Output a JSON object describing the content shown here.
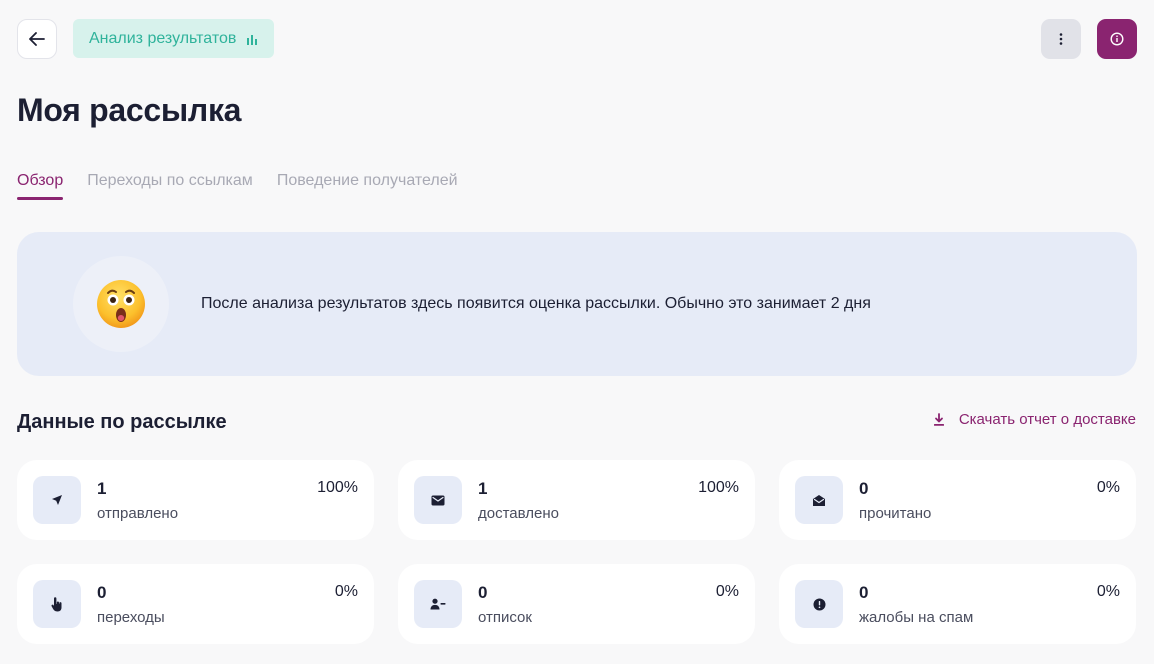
{
  "header": {
    "back_icon": "arrow-left-icon",
    "analysis_label": "Анализ результатов",
    "analysis_icon": "bar-chart-icon",
    "more_icon": "more-vertical-icon",
    "info_icon": "info-icon"
  },
  "page_title": "Моя рассылка",
  "tabs": [
    {
      "label": "Обзор",
      "active": true
    },
    {
      "label": "Переходы по ссылкам",
      "active": false
    },
    {
      "label": "Поведение получателей",
      "active": false
    }
  ],
  "notice": {
    "emoji": "😲",
    "text": "После анализа результатов здесь появится оценка рассылки. Обычно это занимает 2 дня"
  },
  "section": {
    "title": "Данные по рассылке",
    "download_label": "Скачать отчет о доставке",
    "download_icon": "download-icon"
  },
  "stats": [
    {
      "value": "1",
      "label": "отправлено",
      "percent": "100%",
      "icon": "send-icon"
    },
    {
      "value": "1",
      "label": "доставлено",
      "percent": "100%",
      "icon": "envelope-icon"
    },
    {
      "value": "0",
      "label": "прочитано",
      "percent": "0%",
      "icon": "open-envelope-icon"
    },
    {
      "value": "0",
      "label": "переходы",
      "percent": "0%",
      "icon": "pointer-hand-icon"
    },
    {
      "value": "0",
      "label": "отписок",
      "percent": "0%",
      "icon": "user-minus-icon"
    },
    {
      "value": "0",
      "label": "жалобы на спам",
      "percent": "0%",
      "icon": "alert-circle-icon"
    }
  ],
  "colors": {
    "accent": "#8a2470",
    "chip_bg": "#d7f2ec",
    "chip_text": "#2fb39b",
    "notice_bg": "#e6ebf7"
  }
}
